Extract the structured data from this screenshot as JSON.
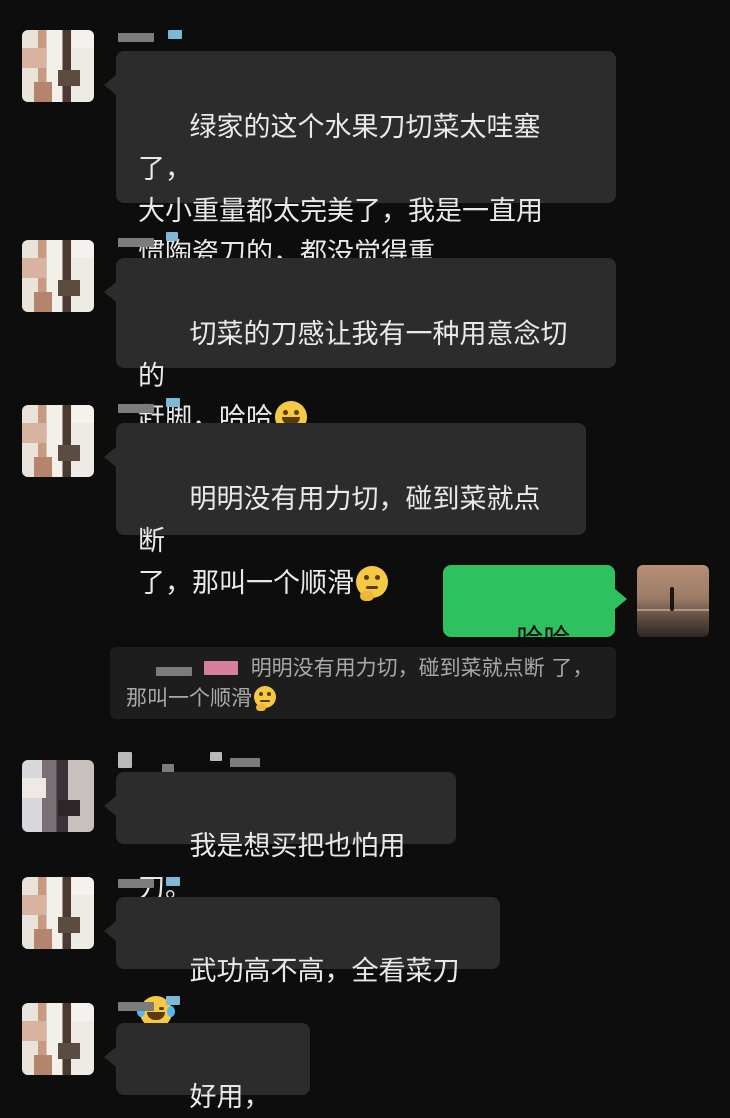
{
  "messages": [
    {
      "text": "绿家的这个水果刀切菜太哇塞了，\n大小重量都太完美了，我是一直用\n惯陶瓷刀的，都没觉得重",
      "emoji": ""
    },
    {
      "text": "切菜的刀感让我有一种用意念切的\n赶脚，哈哈",
      "emoji": "grinning-face"
    },
    {
      "text": "明明没有用力切，碰到菜就点断\n了，那叫一个顺滑",
      "emoji": "thinking-face"
    },
    {
      "text": "哈哈哈哈",
      "emoji": ""
    },
    {
      "text": "我是想买把也怕用刀。",
      "emoji": ""
    },
    {
      "text": "武功高不高，全看菜刀",
      "emoji": "face-with-tears-of-joy"
    },
    {
      "text": "好用，真的",
      "emoji": ""
    }
  ],
  "quote": {
    "text": "明明没有用力切，碰到菜就点断\n了，那叫一个顺滑",
    "emoji": "thinking-face"
  },
  "colors": {
    "background": "#0d0d0d",
    "received_bubble": "#2c2c2c",
    "sent_bubble": "#2fc15f",
    "text": "#e9e9e9"
  }
}
